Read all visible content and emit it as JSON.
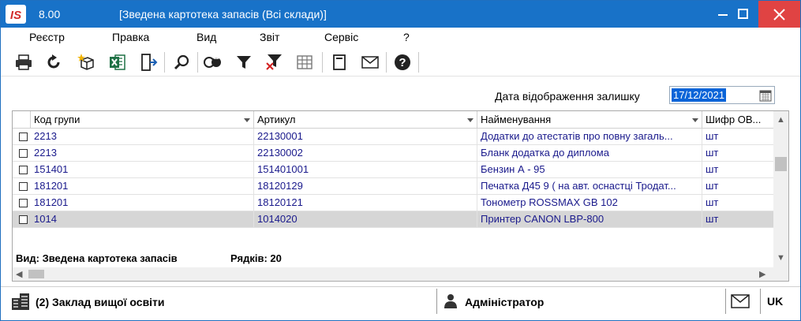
{
  "titlebar": {
    "code": "8.00",
    "title": "[Зведена картотека запасів (Всі склади)]",
    "logo_text": "IS"
  },
  "menu": [
    {
      "label": "Реєстр"
    },
    {
      "label": "Правка"
    },
    {
      "label": "Вид"
    },
    {
      "label": "Звіт"
    },
    {
      "label": "Сервіс"
    },
    {
      "label": "?"
    }
  ],
  "toolbar": {
    "icons": [
      "print-icon",
      "refresh-icon",
      "new-document-icon",
      "excel-export-icon",
      "exit-icon",
      "search-icon",
      "group-icon",
      "filter-icon",
      "clear-filter-icon",
      "grid-settings-icon",
      "document-icon",
      "mail-icon",
      "help-icon"
    ]
  },
  "date": {
    "label": "Дата відображення залишку",
    "value": "17/12/2021"
  },
  "grid": {
    "columns": [
      {
        "label": "Код групи"
      },
      {
        "label": "Артикул"
      },
      {
        "label": "Найменування"
      },
      {
        "label": "Шифр ОВ..."
      }
    ],
    "rows": [
      {
        "group": "2213",
        "article": "22130001",
        "name": "Додатки до атестатів про повну загаль...",
        "unit": "шт",
        "selected": false
      },
      {
        "group": "2213",
        "article": "22130002",
        "name": "Бланк додатка до диплома",
        "unit": "шт",
        "selected": false
      },
      {
        "group": "151401",
        "article": "151401001",
        "name": "Бензин А - 95",
        "unit": "шт",
        "selected": false
      },
      {
        "group": "181201",
        "article": "18120129",
        "name": "Печатка Д45 9 ( на авт. оснастці Тродат...",
        "unit": "шт",
        "selected": false
      },
      {
        "group": "181201",
        "article": "18120121",
        "name": "Тонометр ROSSMAX GB 102",
        "unit": "шт",
        "selected": false
      },
      {
        "group": "1014",
        "article": "1014020",
        "name": "Принтер CANON LBP-800",
        "unit": "шт",
        "selected": true
      }
    ],
    "footer_view": "Вид: Зведена картотека запасів",
    "footer_rows": "Рядків: 20"
  },
  "statusbar": {
    "org": "(2) Заклад вищої освіти",
    "user": "Адміністратор",
    "lang": "UK"
  },
  "colors": {
    "titlebar": "#1872c8",
    "close": "#e04343",
    "row_text": "#1a1a8c",
    "selection": "#d6d6d6",
    "date_highlight": "#0a64d8"
  }
}
